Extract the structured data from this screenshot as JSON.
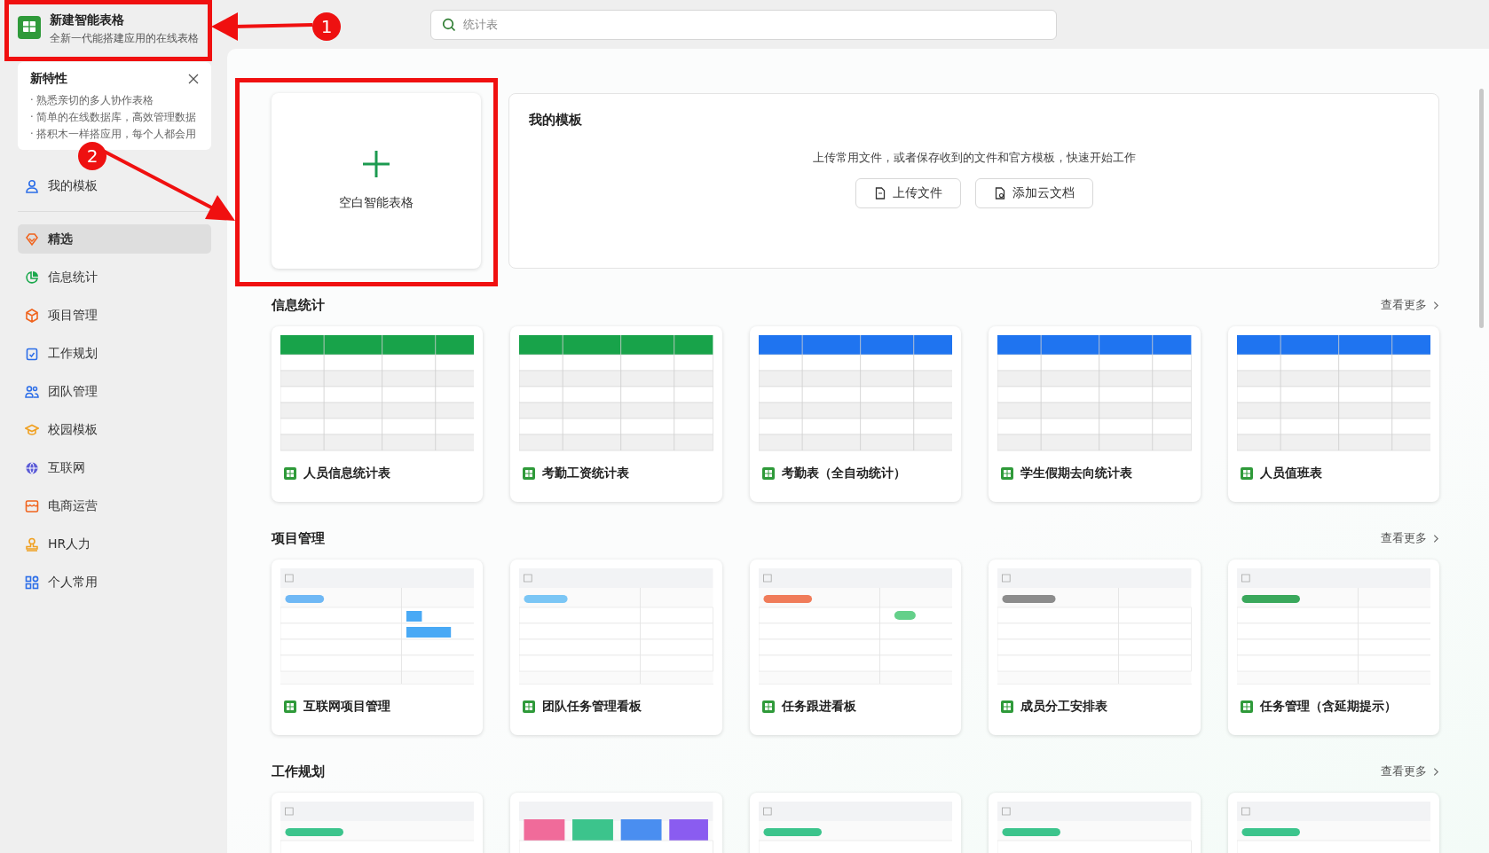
{
  "app": {
    "title": "新建智能表格",
    "subtitle": "全新一代能搭建应用的在线表格"
  },
  "features": {
    "title": "新特性",
    "items": [
      "· 熟悉亲切的多人协作表格",
      "· 简单的在线数据库，高效管理数据",
      "· 搭积木一样搭应用，每个人都会用"
    ]
  },
  "my_templates_link": {
    "label": "我的模板"
  },
  "sidebar": {
    "items": [
      {
        "label": "精选",
        "selected": true
      },
      {
        "label": "信息统计",
        "selected": false
      },
      {
        "label": "项目管理",
        "selected": false
      },
      {
        "label": "工作规划",
        "selected": false
      },
      {
        "label": "团队管理",
        "selected": false
      },
      {
        "label": "校园模板",
        "selected": false
      },
      {
        "label": "互联网",
        "selected": false
      },
      {
        "label": "电商运营",
        "selected": false
      },
      {
        "label": "HR人力",
        "selected": false
      },
      {
        "label": "个人常用",
        "selected": false
      }
    ]
  },
  "search": {
    "placeholder": "统计表"
  },
  "blank_card": {
    "label": "空白智能表格"
  },
  "my_templates": {
    "title": "我的模板",
    "hint": "上传常用文件，或者保存收到的文件和官方模板，快速开始工作",
    "buttons": [
      "上传文件",
      "添加云文档"
    ]
  },
  "sections": [
    {
      "title": "信息统计",
      "more": "查看更多",
      "templates": [
        {
          "kind": "picture",
          "title": "人员信息统计表"
        },
        {
          "kind": "picture",
          "title": "考勤工资统计表"
        },
        {
          "kind": "picture",
          "title": "考勤表（全自动统计）"
        },
        {
          "kind": "picture",
          "title": "学生假期去向统计表"
        },
        {
          "kind": "picture",
          "title": "人员值班表"
        }
      ]
    },
    {
      "title": "项目管理",
      "more": "查看更多",
      "templates": [
        {
          "kind": "picture",
          "title": "互联网项目管理"
        },
        {
          "kind": "picture",
          "title": "团队任务管理看板"
        },
        {
          "kind": "picture",
          "title": "任务跟进看板"
        },
        {
          "kind": "picture",
          "title": "成员分工安排表"
        },
        {
          "kind": "picture",
          "title": "任务管理（含延期提示）"
        }
      ]
    },
    {
      "title": "工作规划",
      "more": "查看更多"
    }
  ],
  "annotations": [
    "1",
    "2"
  ]
}
